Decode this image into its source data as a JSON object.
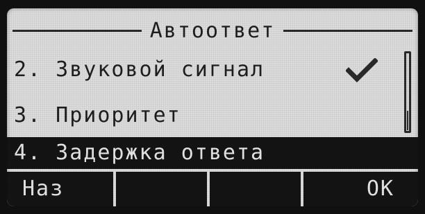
{
  "screen": {
    "title": "Автоответ"
  },
  "menu": {
    "items": [
      {
        "label": "2. Звуковой сигнал",
        "checked": true
      },
      {
        "label": "3. Приоритет",
        "checked": false
      },
      {
        "label": "4. Задержка ответа",
        "selected": true
      }
    ]
  },
  "softkeys": {
    "left": "Наз",
    "middle1": "",
    "middle2": "",
    "right": "OK"
  },
  "colors": {
    "lcd_background": "#dcdcdc",
    "ink": "#1e1e1e",
    "highlight": "#141414",
    "highlight_text": "#e6e6e6"
  },
  "icons": {
    "check": "check-icon"
  }
}
